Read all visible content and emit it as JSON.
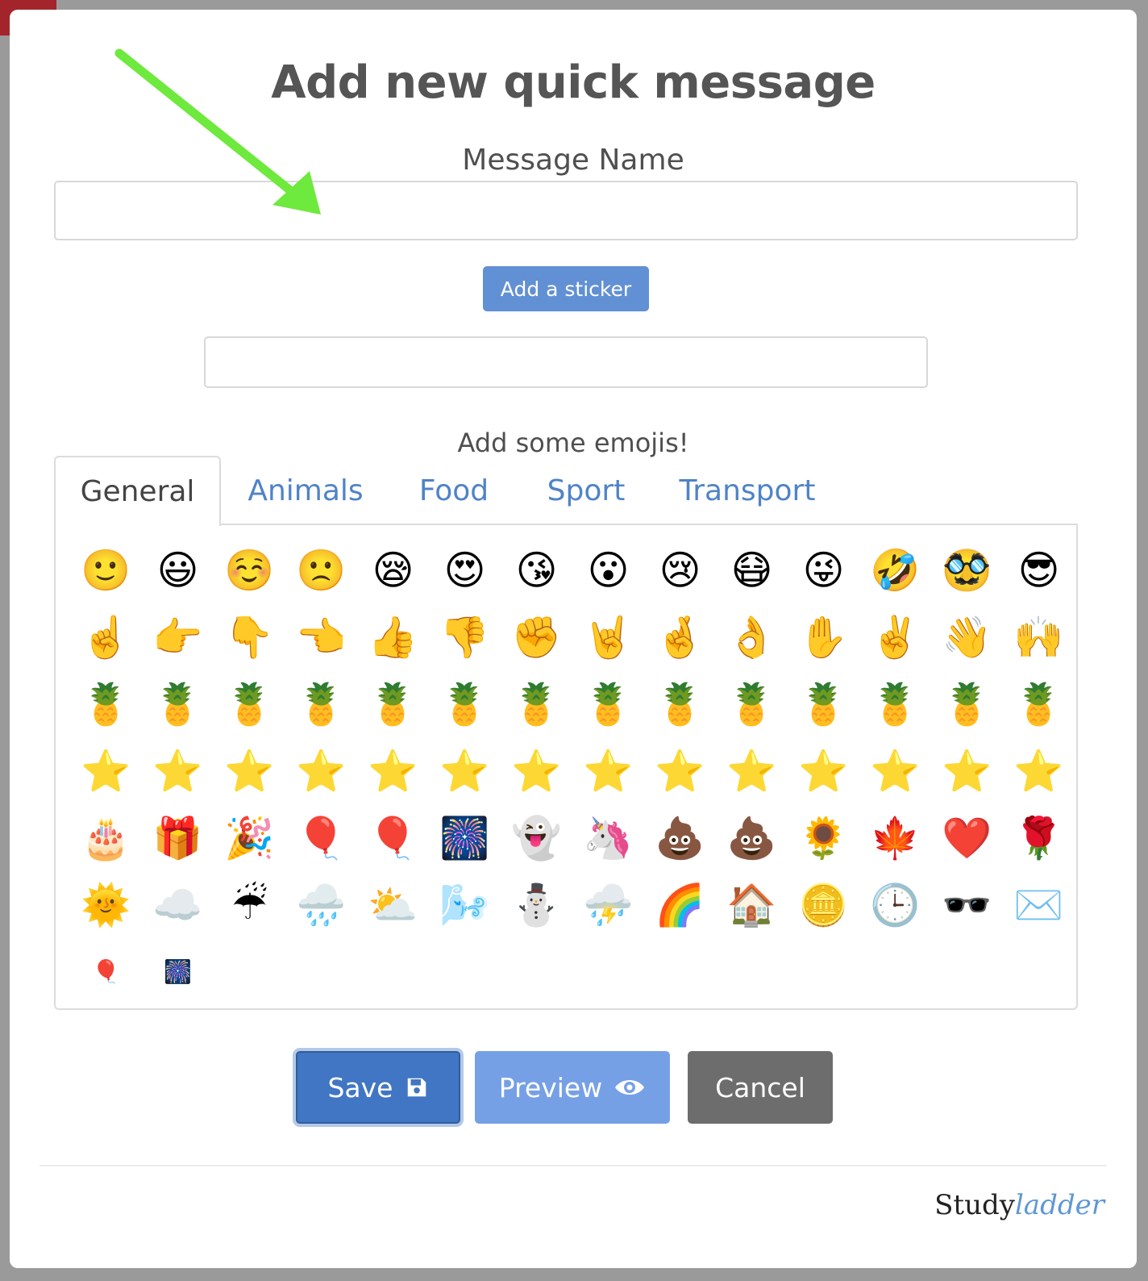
{
  "modal": {
    "title": "Add new quick message",
    "message_name_label": "Message Name",
    "message_name_value": "",
    "sticker_button": "Add a sticker",
    "sticker_value": "",
    "emoji_heading": "Add some emojis!"
  },
  "tabs": [
    {
      "label": "General",
      "active": true
    },
    {
      "label": "Animals",
      "active": false
    },
    {
      "label": "Food",
      "active": false
    },
    {
      "label": "Sport",
      "active": false
    },
    {
      "label": "Transport",
      "active": false
    }
  ],
  "emojis": [
    "🙂",
    "😃",
    "☺️",
    "🙁",
    "😪",
    "😍",
    "😘",
    "😮",
    "😢",
    "😷",
    "😜",
    "🤣",
    "🥸",
    "😎",
    "☝️",
    "👉",
    "👇",
    "👈",
    "👍",
    "👎",
    "✊",
    "🤘",
    "🤞",
    "👌",
    "✋",
    "✌️",
    "👋",
    "🙌",
    "🍍",
    "🍍",
    "🍍",
    "🍍",
    "🍍",
    "🍍",
    "🍍",
    "🍍",
    "🍍",
    "🍍",
    "🍍",
    "🍍",
    "🍍",
    "🍍",
    "⭐",
    "⭐",
    "⭐",
    "⭐",
    "⭐",
    "⭐",
    "⭐",
    "⭐",
    "⭐",
    "⭐",
    "⭐",
    "⭐",
    "⭐",
    "⭐",
    "🎂",
    "🎁",
    "🎉",
    "🎈",
    "🎈",
    "🎆",
    "👻",
    "🦄",
    "💩",
    "💩",
    "🌻",
    "🍁",
    "❤️",
    "🌹",
    "🌞",
    "☁️",
    "☔",
    "🌧️",
    "⛅",
    "🌬️",
    "⛄",
    "⛈️",
    "🌈",
    "🏠",
    "🪙",
    "🕒",
    "🕶️",
    "✉️"
  ],
  "emojis_small": [
    "🎈",
    "🎆"
  ],
  "buttons": {
    "save": "Save",
    "preview": "Preview",
    "cancel": "Cancel"
  },
  "brand": {
    "main": "Study",
    "accent": "ladder"
  },
  "colors": {
    "primary": "#4076c3",
    "preview": "#76a0e6",
    "cancel": "#6d6d6d",
    "arrow": "#6ee93d"
  },
  "icons": {
    "save": "floppy-disk-icon",
    "preview": "eye-icon",
    "annotation": "green-arrow-icon"
  }
}
